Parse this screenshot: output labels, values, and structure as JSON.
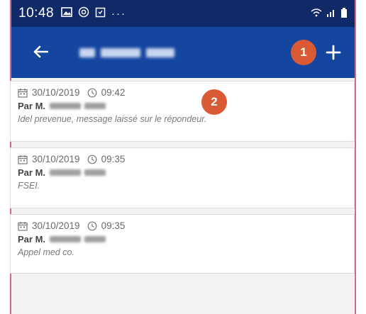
{
  "statusbar": {
    "time": "10:48",
    "icons": [
      "image-icon",
      "at-icon",
      "notification-icon",
      "more-dots-icon"
    ],
    "right_icons": [
      "wifi-icon",
      "signal-icon",
      "battery-icon"
    ]
  },
  "appbar": {
    "back_icon": "arrow-left-icon",
    "title": "",
    "add_icon": "plus-icon"
  },
  "annotations": {
    "badge1": "1",
    "badge2": "2"
  },
  "entries": [
    {
      "date": "30/10/2019",
      "time": "09:42",
      "author_prefix": "Par M.",
      "note": "Idel prevenue, message laissé sur le répondeur."
    },
    {
      "date": "30/10/2019",
      "time": "09:35",
      "author_prefix": "Par M.",
      "note": "FSEI."
    },
    {
      "date": "30/10/2019",
      "time": "09:35",
      "author_prefix": "Par M.",
      "note": "Appel med co."
    }
  ],
  "colors": {
    "statusbar_bg": "#0f2a66",
    "appbar_bg": "#1446a0",
    "badge_bg": "#d95a34",
    "border_accent": "#d36a8a"
  }
}
